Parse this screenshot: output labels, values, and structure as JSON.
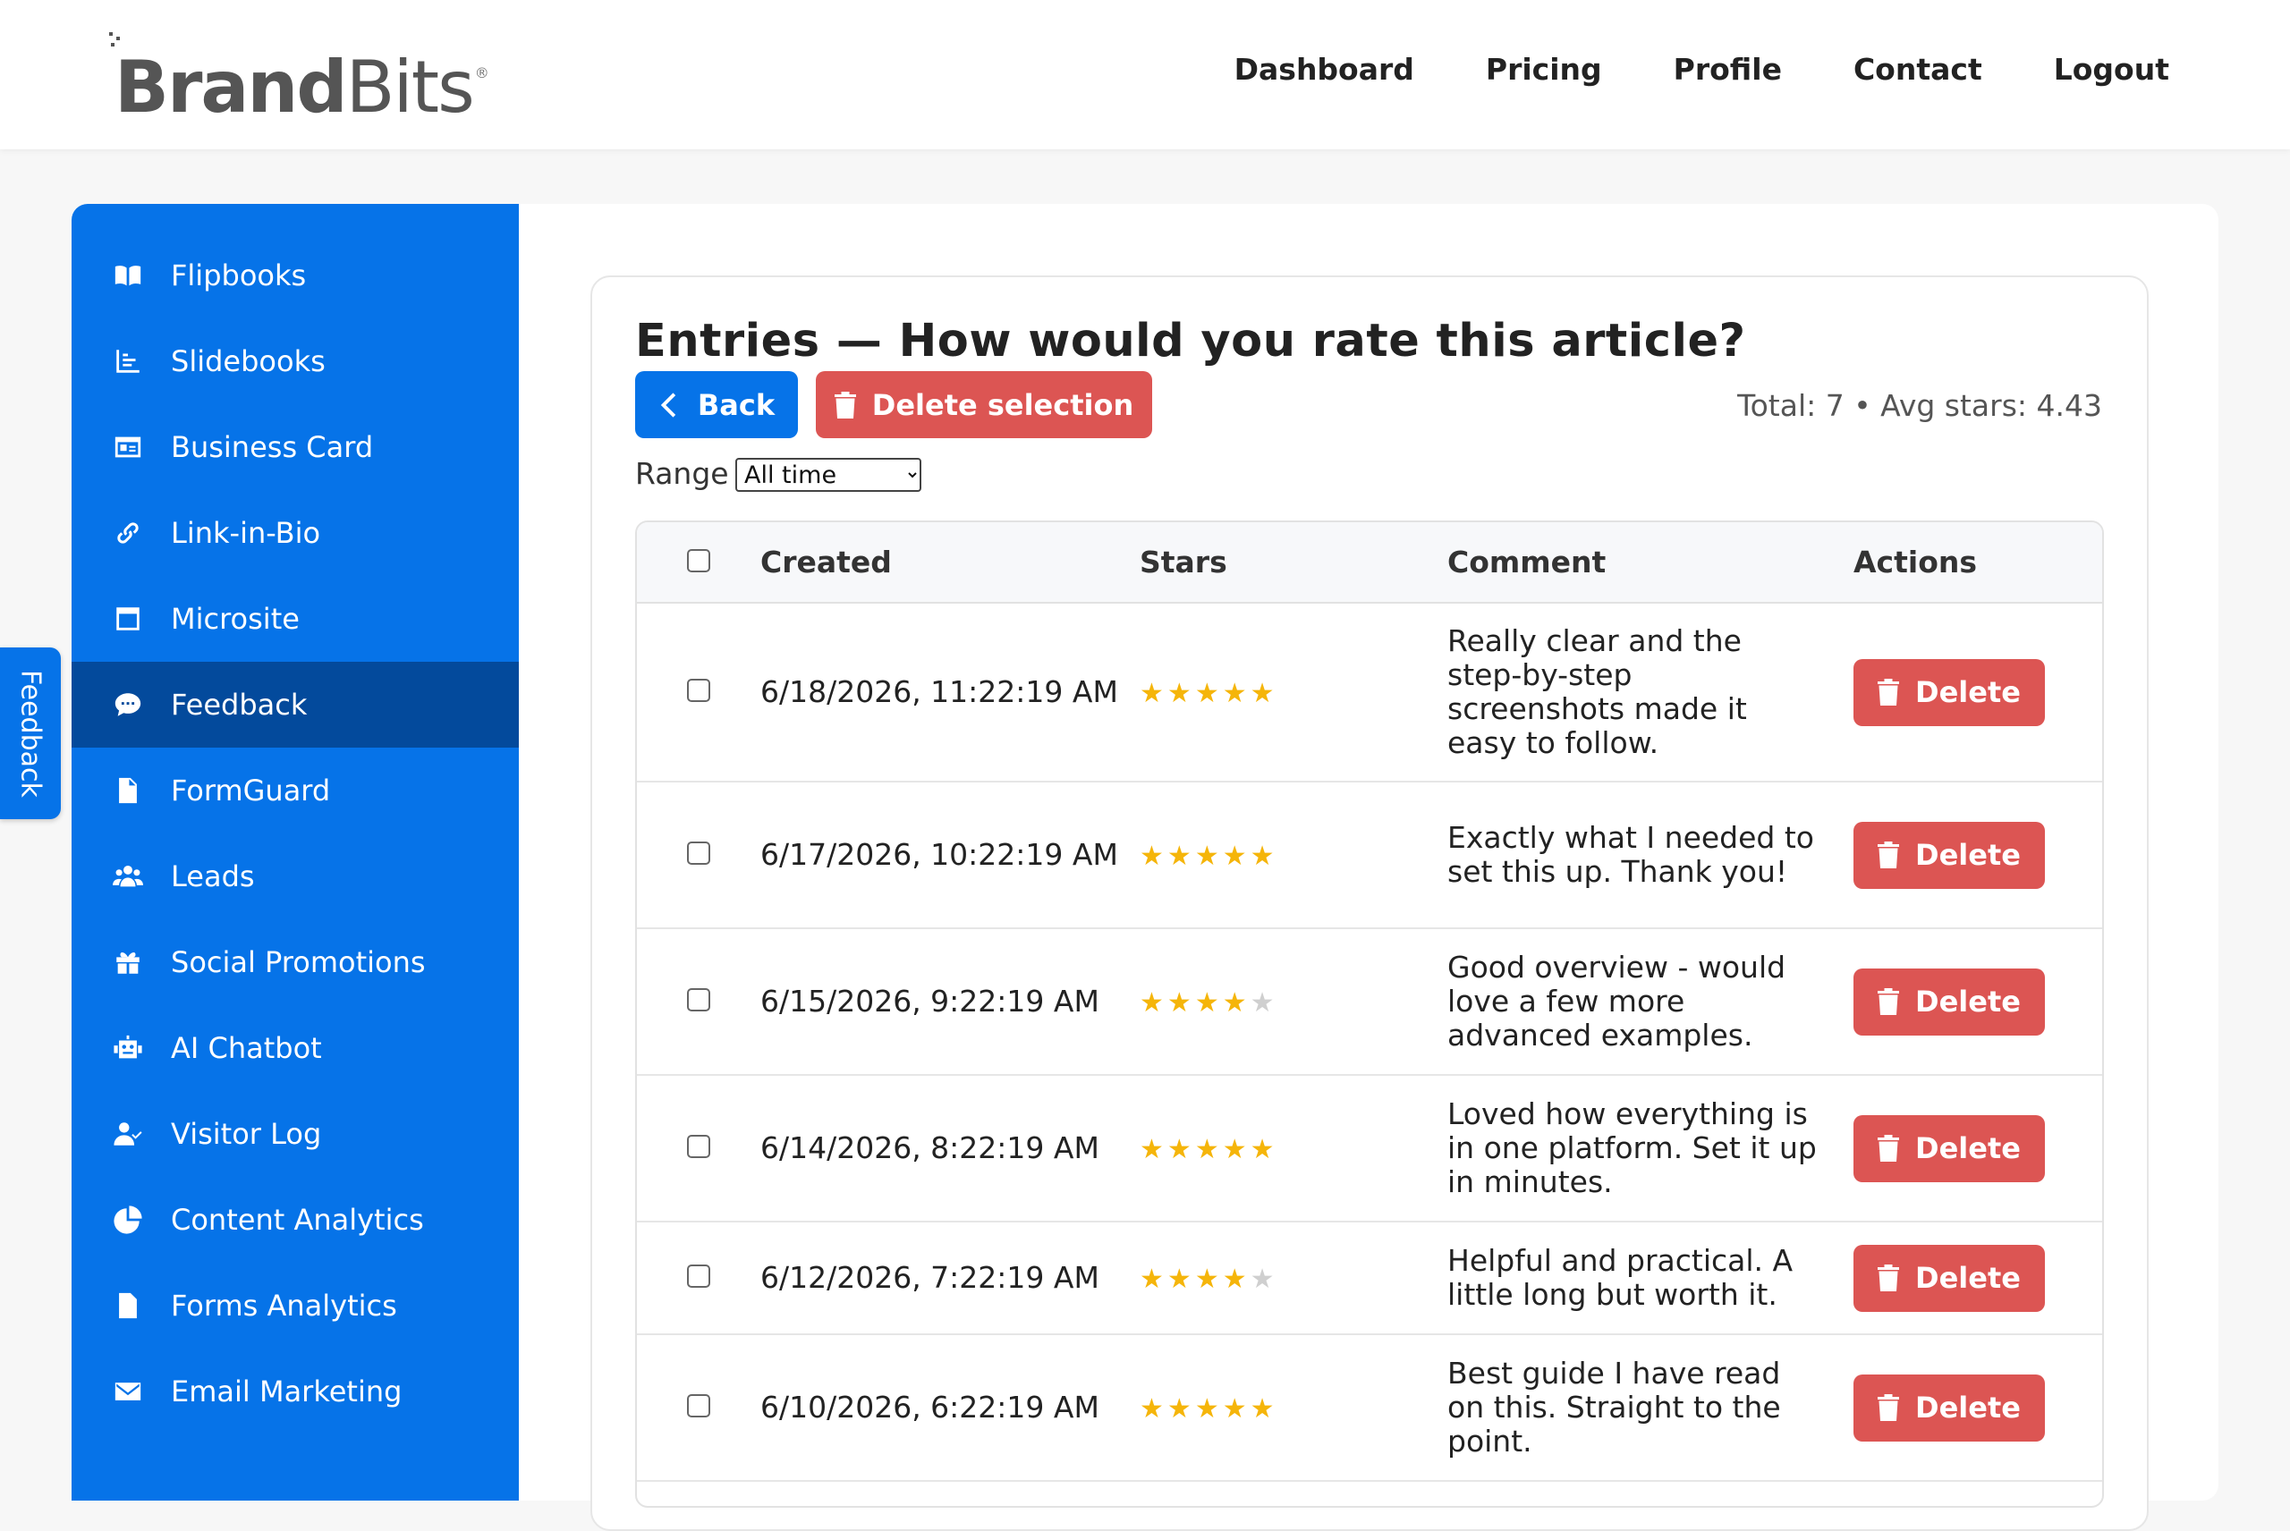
{
  "brand": {
    "bold": "Brand",
    "light": "Bits",
    "reg": "®"
  },
  "nav": [
    "Dashboard",
    "Pricing",
    "Profile",
    "Contact",
    "Logout"
  ],
  "sidebar": {
    "items": [
      {
        "label": "Flipbooks",
        "icon": "book-open-icon"
      },
      {
        "label": "Slidebooks",
        "icon": "chart-bars-icon"
      },
      {
        "label": "Business Card",
        "icon": "id-card-icon"
      },
      {
        "label": "Link-in-Bio",
        "icon": "link-icon"
      },
      {
        "label": "Microsite",
        "icon": "window-icon"
      },
      {
        "label": "Feedback",
        "icon": "comment-dots-icon",
        "active": true
      },
      {
        "label": "FormGuard",
        "icon": "file-icon"
      },
      {
        "label": "Leads",
        "icon": "users-icon"
      },
      {
        "label": "Social Promotions",
        "icon": "gift-icon"
      },
      {
        "label": "AI Chatbot",
        "icon": "robot-icon"
      },
      {
        "label": "Visitor Log",
        "icon": "user-check-icon"
      },
      {
        "label": "Content Analytics",
        "icon": "pie-chart-icon"
      },
      {
        "label": "Forms Analytics",
        "icon": "file-lines-icon"
      },
      {
        "label": "Email Marketing",
        "icon": "envelope-icon"
      }
    ]
  },
  "feedback_tab": "Feedback",
  "page": {
    "title": "Entries — How would you rate this article?",
    "back_label": "Back",
    "delete_selection_label": "Delete selection",
    "summary": "Total: 7 • Avg stars: 4.43",
    "range_label": "Range",
    "range_value": "All time"
  },
  "table": {
    "headers": [
      "Created",
      "Stars",
      "Comment",
      "Actions"
    ],
    "delete_label": "Delete",
    "rows": [
      {
        "created": "6/18/2026, 11:22:19 AM",
        "stars": 5,
        "comment": "Really clear and the step-by-step screenshots made it easy to follow."
      },
      {
        "created": "6/17/2026, 10:22:19 AM",
        "stars": 5,
        "comment": "Exactly what I needed to set this up. Thank you!"
      },
      {
        "created": "6/15/2026, 9:22:19 AM",
        "stars": 4,
        "comment": "Good overview - would love a few more advanced examples."
      },
      {
        "created": "6/14/2026, 8:22:19 AM",
        "stars": 5,
        "comment": "Loved how everything is in one platform. Set it up in minutes."
      },
      {
        "created": "6/12/2026, 7:22:19 AM",
        "stars": 4,
        "comment": "Helpful and practical. A little long but worth it."
      },
      {
        "created": "6/10/2026, 6:22:19 AM",
        "stars": 5,
        "comment": "Best guide I have read on this. Straight to the point."
      }
    ]
  },
  "colors": {
    "primary": "#0673e8",
    "sidebar_active": "#034a9c",
    "danger": "#dc5553",
    "star": "#f5b50a",
    "star_empty": "#cfcfcf"
  }
}
